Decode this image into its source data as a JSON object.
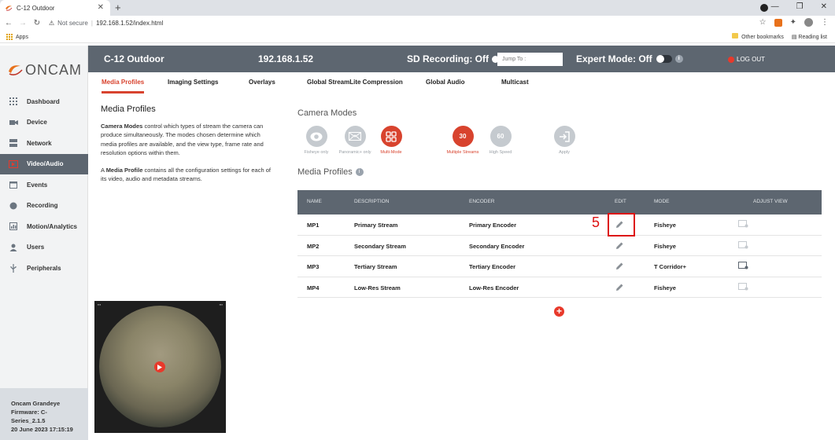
{
  "browser": {
    "tab_title": "C-12 Outdoor",
    "new_tab": "+",
    "not_secure": "Not secure",
    "url": "192.168.1.52/index.html",
    "apps_label": "Apps",
    "other_bookmarks": "Other bookmarks",
    "reading_list": "Reading list"
  },
  "sidebar": {
    "logo": "ONCAM",
    "items": [
      {
        "label": "Dashboard",
        "icon": "grid-icon"
      },
      {
        "label": "Device",
        "icon": "camera-icon"
      },
      {
        "label": "Network",
        "icon": "network-icon"
      },
      {
        "label": "Video/Audio",
        "icon": "video-icon"
      },
      {
        "label": "Events",
        "icon": "calendar-icon"
      },
      {
        "label": "Recording",
        "icon": "record-icon"
      },
      {
        "label": "Motion/Analytics",
        "icon": "analytics-icon"
      },
      {
        "label": "Users",
        "icon": "user-icon"
      },
      {
        "label": "Peripherals",
        "icon": "usb-icon"
      }
    ],
    "footer": {
      "model": "Oncam Grandeye",
      "firmware1": "Firmware: C-",
      "firmware2": "Series_2.1.5",
      "datetime": "20 June 2023 17:15:19"
    }
  },
  "header": {
    "title": "C-12 Outdoor",
    "ip": "192.168.1.52",
    "sd_recording": "SD Recording: Off",
    "jump_placeholder": "Jump To :",
    "expert_mode": "Expert Mode: Off",
    "info": "i",
    "logout": "LOG OUT"
  },
  "tabs": [
    "Media Profiles",
    "Imaging Settings",
    "Overlays",
    "Global StreamLite Compression",
    "Global Audio",
    "Multicast"
  ],
  "description": {
    "title": "Media Profiles",
    "p1_bold": "Camera Modes",
    "p1_rest": " control which types of stream the camera can produce simultaneously. The modes chosen determine which media profiles are available, and the view type, frame rate and resolution options within them.",
    "p2_pre": "A ",
    "p2_bold": "Media Profile",
    "p2_rest": " contains all the configuration settings for each of its video, audio and metadata streams."
  },
  "camera_modes": {
    "title": "Camera Modes",
    "modes": [
      {
        "label": "Fisheye only"
      },
      {
        "label": "Panoramic+ only"
      },
      {
        "label": "Multi-Mode"
      },
      {
        "label": "Multiple Streams",
        "badge": "30"
      },
      {
        "label": "High Speed",
        "badge": "60"
      },
      {
        "label": "Apply"
      }
    ]
  },
  "media_profiles": {
    "title": "Media Profiles",
    "info": "i",
    "columns": [
      "NAME",
      "DESCRIPTION",
      "ENCODER",
      "EDIT",
      "MODE",
      "ADJUST VIEW"
    ],
    "rows": [
      {
        "name": "MP1",
        "description": "Primary Stream",
        "encoder": "Primary Encoder",
        "mode": "Fisheye"
      },
      {
        "name": "MP2",
        "description": "Secondary Stream",
        "encoder": "Secondary Encoder",
        "mode": "Fisheye"
      },
      {
        "name": "MP3",
        "description": "Tertiary Stream",
        "encoder": "Tertiary Encoder",
        "mode": "T Corridor+"
      },
      {
        "name": "MP4",
        "description": "Low-Res Stream",
        "encoder": "Low-Res Encoder",
        "mode": "Fisheye"
      }
    ],
    "add": "+"
  },
  "annotation": {
    "step": "5"
  },
  "colors": {
    "accent": "#d8432e",
    "header": "#5d6670",
    "annotation": "#dd1111"
  }
}
